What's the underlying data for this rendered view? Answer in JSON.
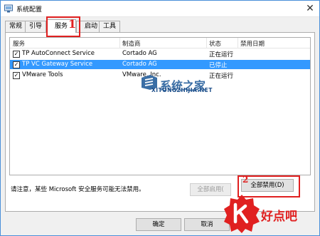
{
  "window": {
    "title": "系统配置"
  },
  "tabs": [
    {
      "label": "常规"
    },
    {
      "label": "引导"
    },
    {
      "label": "服务"
    },
    {
      "label": "启动"
    },
    {
      "label": "工具"
    }
  ],
  "annotations": {
    "step1": "1",
    "step2": "2"
  },
  "list": {
    "headers": {
      "service": "服务",
      "manufacturer": "制造商",
      "status": "状态",
      "disabled_date": "禁用日期"
    },
    "rows": [
      {
        "service": "TP AutoConnect Service",
        "manufacturer": "Cortado AG",
        "status": "正在运行",
        "checked": true,
        "selected": false
      },
      {
        "service": "TP VC Gateway Service",
        "manufacturer": "Cortado AG",
        "status": "已停止",
        "checked": true,
        "selected": true
      },
      {
        "service": "VMware Tools",
        "manufacturer": "VMware, Inc.",
        "status": "正在运行",
        "checked": true,
        "selected": false
      }
    ]
  },
  "note": "请注意，某些 Microsoft 安全服务可能无法禁用。",
  "buttons": {
    "enable_all": "全部启用(",
    "disable_all": "全部禁用(D)",
    "ok": "确定",
    "cancel": "取消"
  },
  "watermarks": {
    "site_name": "系统之家",
    "site_url": "XITONGZHIJIA.NET",
    "brand2": "好点吧"
  },
  "colors": {
    "selection": "#3399ff",
    "annotation": "#e02020",
    "watermark_blue": "#3a6ea5"
  }
}
